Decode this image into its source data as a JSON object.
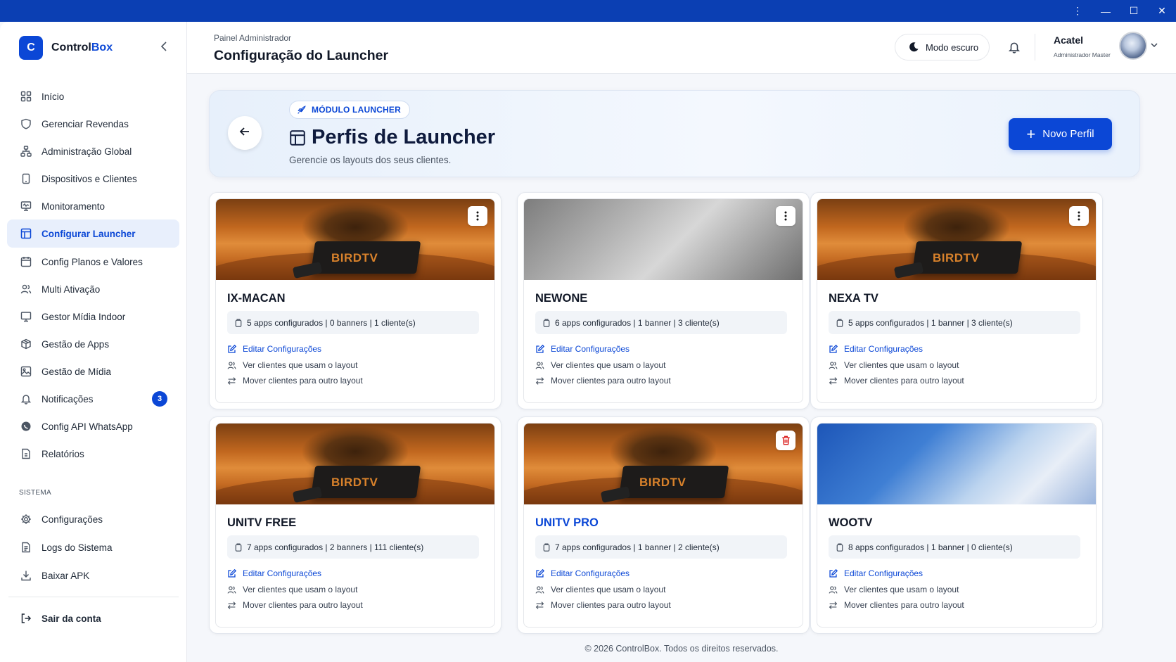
{
  "window": {
    "controls": [
      "⋮",
      "—",
      "☐",
      "✕"
    ]
  },
  "brand": {
    "logo_letter": "C",
    "name_part1": "Control",
    "name_part2": "Box",
    "accent": "#0b47d6"
  },
  "sidebar": {
    "items": [
      {
        "label": "Início",
        "icon": "grid-icon"
      },
      {
        "label": "Gerenciar Revendas",
        "icon": "shield-icon"
      },
      {
        "label": "Administração Global",
        "icon": "network-icon"
      },
      {
        "label": "Dispositivos e Clientes",
        "icon": "device-icon"
      },
      {
        "label": "Monitoramento",
        "icon": "monitor-icon"
      },
      {
        "label": "Configurar Launcher",
        "icon": "layout-icon",
        "active": true
      },
      {
        "label": "Config Planos e Valores",
        "icon": "calendar-icon"
      },
      {
        "label": "Multi Ativação",
        "icon": "users-icon"
      },
      {
        "label": "Gestor Mídia Indoor",
        "icon": "display-icon"
      },
      {
        "label": "Gestão de Apps",
        "icon": "package-icon"
      },
      {
        "label": "Gestão de Mídia",
        "icon": "image-icon"
      },
      {
        "label": "Notificações",
        "icon": "bell-icon",
        "badge": "3"
      },
      {
        "label": "Config API WhatsApp",
        "icon": "whatsapp-icon"
      },
      {
        "label": "Relatórios",
        "icon": "file-icon"
      }
    ],
    "section_label": "SISTEMA",
    "system_items": [
      {
        "label": "Configurações",
        "icon": "gear-icon"
      },
      {
        "label": "Logs do Sistema",
        "icon": "file-text-icon"
      },
      {
        "label": "Baixar APK",
        "icon": "download-icon"
      }
    ],
    "logout": "Sair da conta"
  },
  "header": {
    "breadcrumb": "Painel Administrador",
    "title": "Configuração do Launcher",
    "dark_mode_label": "Modo escuro",
    "user_name": "Acatel",
    "user_role": "Administrador Master"
  },
  "hero": {
    "module_pill": "MÓDULO LAUNCHER",
    "title": "Perfis de Launcher",
    "subtitle": "Gerencie os layouts dos seus clientes.",
    "new_button": "Novo Perfil"
  },
  "cards": [
    {
      "name": "IX-MACAN",
      "stats": "5 apps configurados | 0 banners | 1 cliente(s)",
      "image": "birdtv",
      "image_text": "BIRDTV",
      "action_icon": "kebab"
    },
    {
      "name": "NEWONE",
      "stats": "6 apps configurados | 1 banner | 3 cliente(s)",
      "image": "gray",
      "action_icon": "kebab"
    },
    {
      "name": "NEXA TV",
      "stats": "5 apps configurados | 1 banner | 3 cliente(s)",
      "image": "birdtv",
      "image_text": "BIRDTV",
      "action_icon": "kebab"
    },
    {
      "name": "UNITV FREE",
      "stats": "7 apps configurados | 2 banners | 111 cliente(s)",
      "image": "birdtv",
      "image_text": "BIRDTV",
      "action_icon": "none"
    },
    {
      "name": "UNITV PRO",
      "stats": "7 apps configurados | 1 banner | 2 cliente(s)",
      "image": "birdtv",
      "image_text": "BIRDTV",
      "action_icon": "trash",
      "highlight": true
    },
    {
      "name": "WOOTV",
      "stats": "8 apps configurados | 1 banner | 0 cliente(s)",
      "image": "blue",
      "action_icon": "none"
    }
  ],
  "card_actions": {
    "edit": "Editar Configurações",
    "view_clients": "Ver clientes que usam o layout",
    "move_clients": "Mover clientes para outro layout"
  },
  "footer": "© 2026 ControlBox. Todos os direitos reservados."
}
